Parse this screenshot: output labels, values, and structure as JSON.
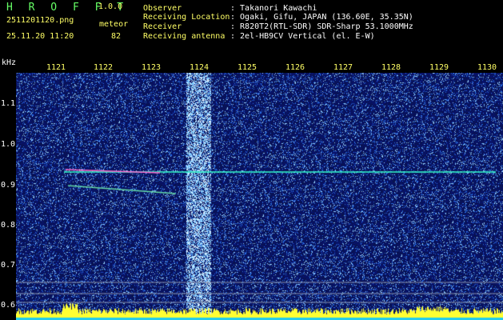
{
  "header": {
    "app_title": "H R O F F T",
    "version": "1.0.0",
    "filename": "2511201120.png",
    "mode": "meteor",
    "datetime": "25.11.20 11:20",
    "count": "82"
  },
  "info": [
    {
      "key": "Observer",
      "value": ": Takanori Kawachi"
    },
    {
      "key": "Receiving Location",
      "value": ": Ogaki, Gifu, JAPAN (136.60E, 35.35N)"
    },
    {
      "key": "Receiver",
      "value": ": R820T2(RTL-SDR) SDR-Sharp 53.1000MHz"
    },
    {
      "key": "Receiving antenna",
      "value": ": 2el-HB9CV Vertical (el. E-W)"
    }
  ],
  "axes": {
    "y_unit": "kHz",
    "y_labels": [
      "1.1",
      "1.0",
      "0.9",
      "0.8",
      "0.7",
      "0.6"
    ],
    "time_labels": [
      "1121",
      "1122",
      "1123",
      "1124",
      "1125",
      "1126",
      "1127",
      "1128",
      "1129",
      "1130"
    ]
  },
  "colors": {
    "background": "#000000",
    "noise": "#0a2a8f",
    "trace": "#33ffcc",
    "header_yellow": "#ffff66",
    "title_green": "#66ff66"
  }
}
